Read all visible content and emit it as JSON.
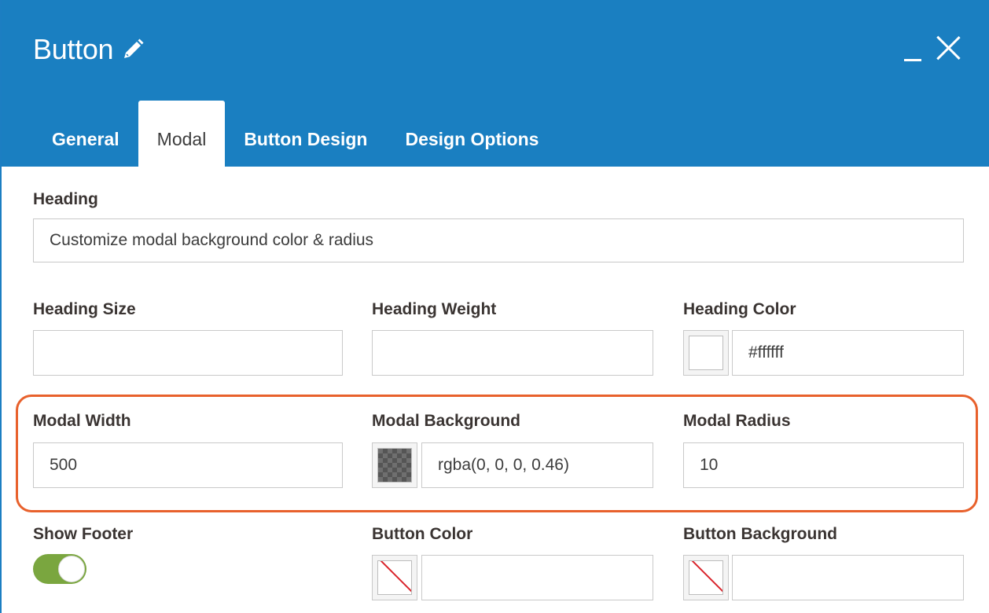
{
  "header": {
    "title": "Button",
    "title_icon": "pencil-icon",
    "minimize_icon": "minimize-icon",
    "close_icon": "close-icon"
  },
  "tabs": [
    {
      "label": "General",
      "active": false
    },
    {
      "label": "Modal",
      "active": true
    },
    {
      "label": "Button Design",
      "active": false
    },
    {
      "label": "Design Options",
      "active": false
    }
  ],
  "form": {
    "heading": {
      "label": "Heading",
      "value": "Customize modal background color & radius"
    },
    "heading_size": {
      "label": "Heading Size",
      "value": ""
    },
    "heading_weight": {
      "label": "Heading Weight",
      "value": ""
    },
    "heading_color": {
      "label": "Heading Color",
      "value": "#ffffff",
      "swatch": "#ffffff"
    },
    "modal_width": {
      "label": "Modal Width",
      "value": "500"
    },
    "modal_background": {
      "label": "Modal Background",
      "value": "rgba(0, 0, 0, 0.46)"
    },
    "modal_radius": {
      "label": "Modal Radius",
      "value": "10"
    },
    "show_footer": {
      "label": "Show Footer",
      "on": true
    },
    "button_color": {
      "label": "Button Color",
      "value": ""
    },
    "button_background": {
      "label": "Button Background",
      "value": ""
    }
  },
  "colors": {
    "header_bg": "#1a7fc1",
    "highlight": "#e8612c",
    "toggle_on": "#7aa63f",
    "no_color_slash": "#d9232a"
  }
}
